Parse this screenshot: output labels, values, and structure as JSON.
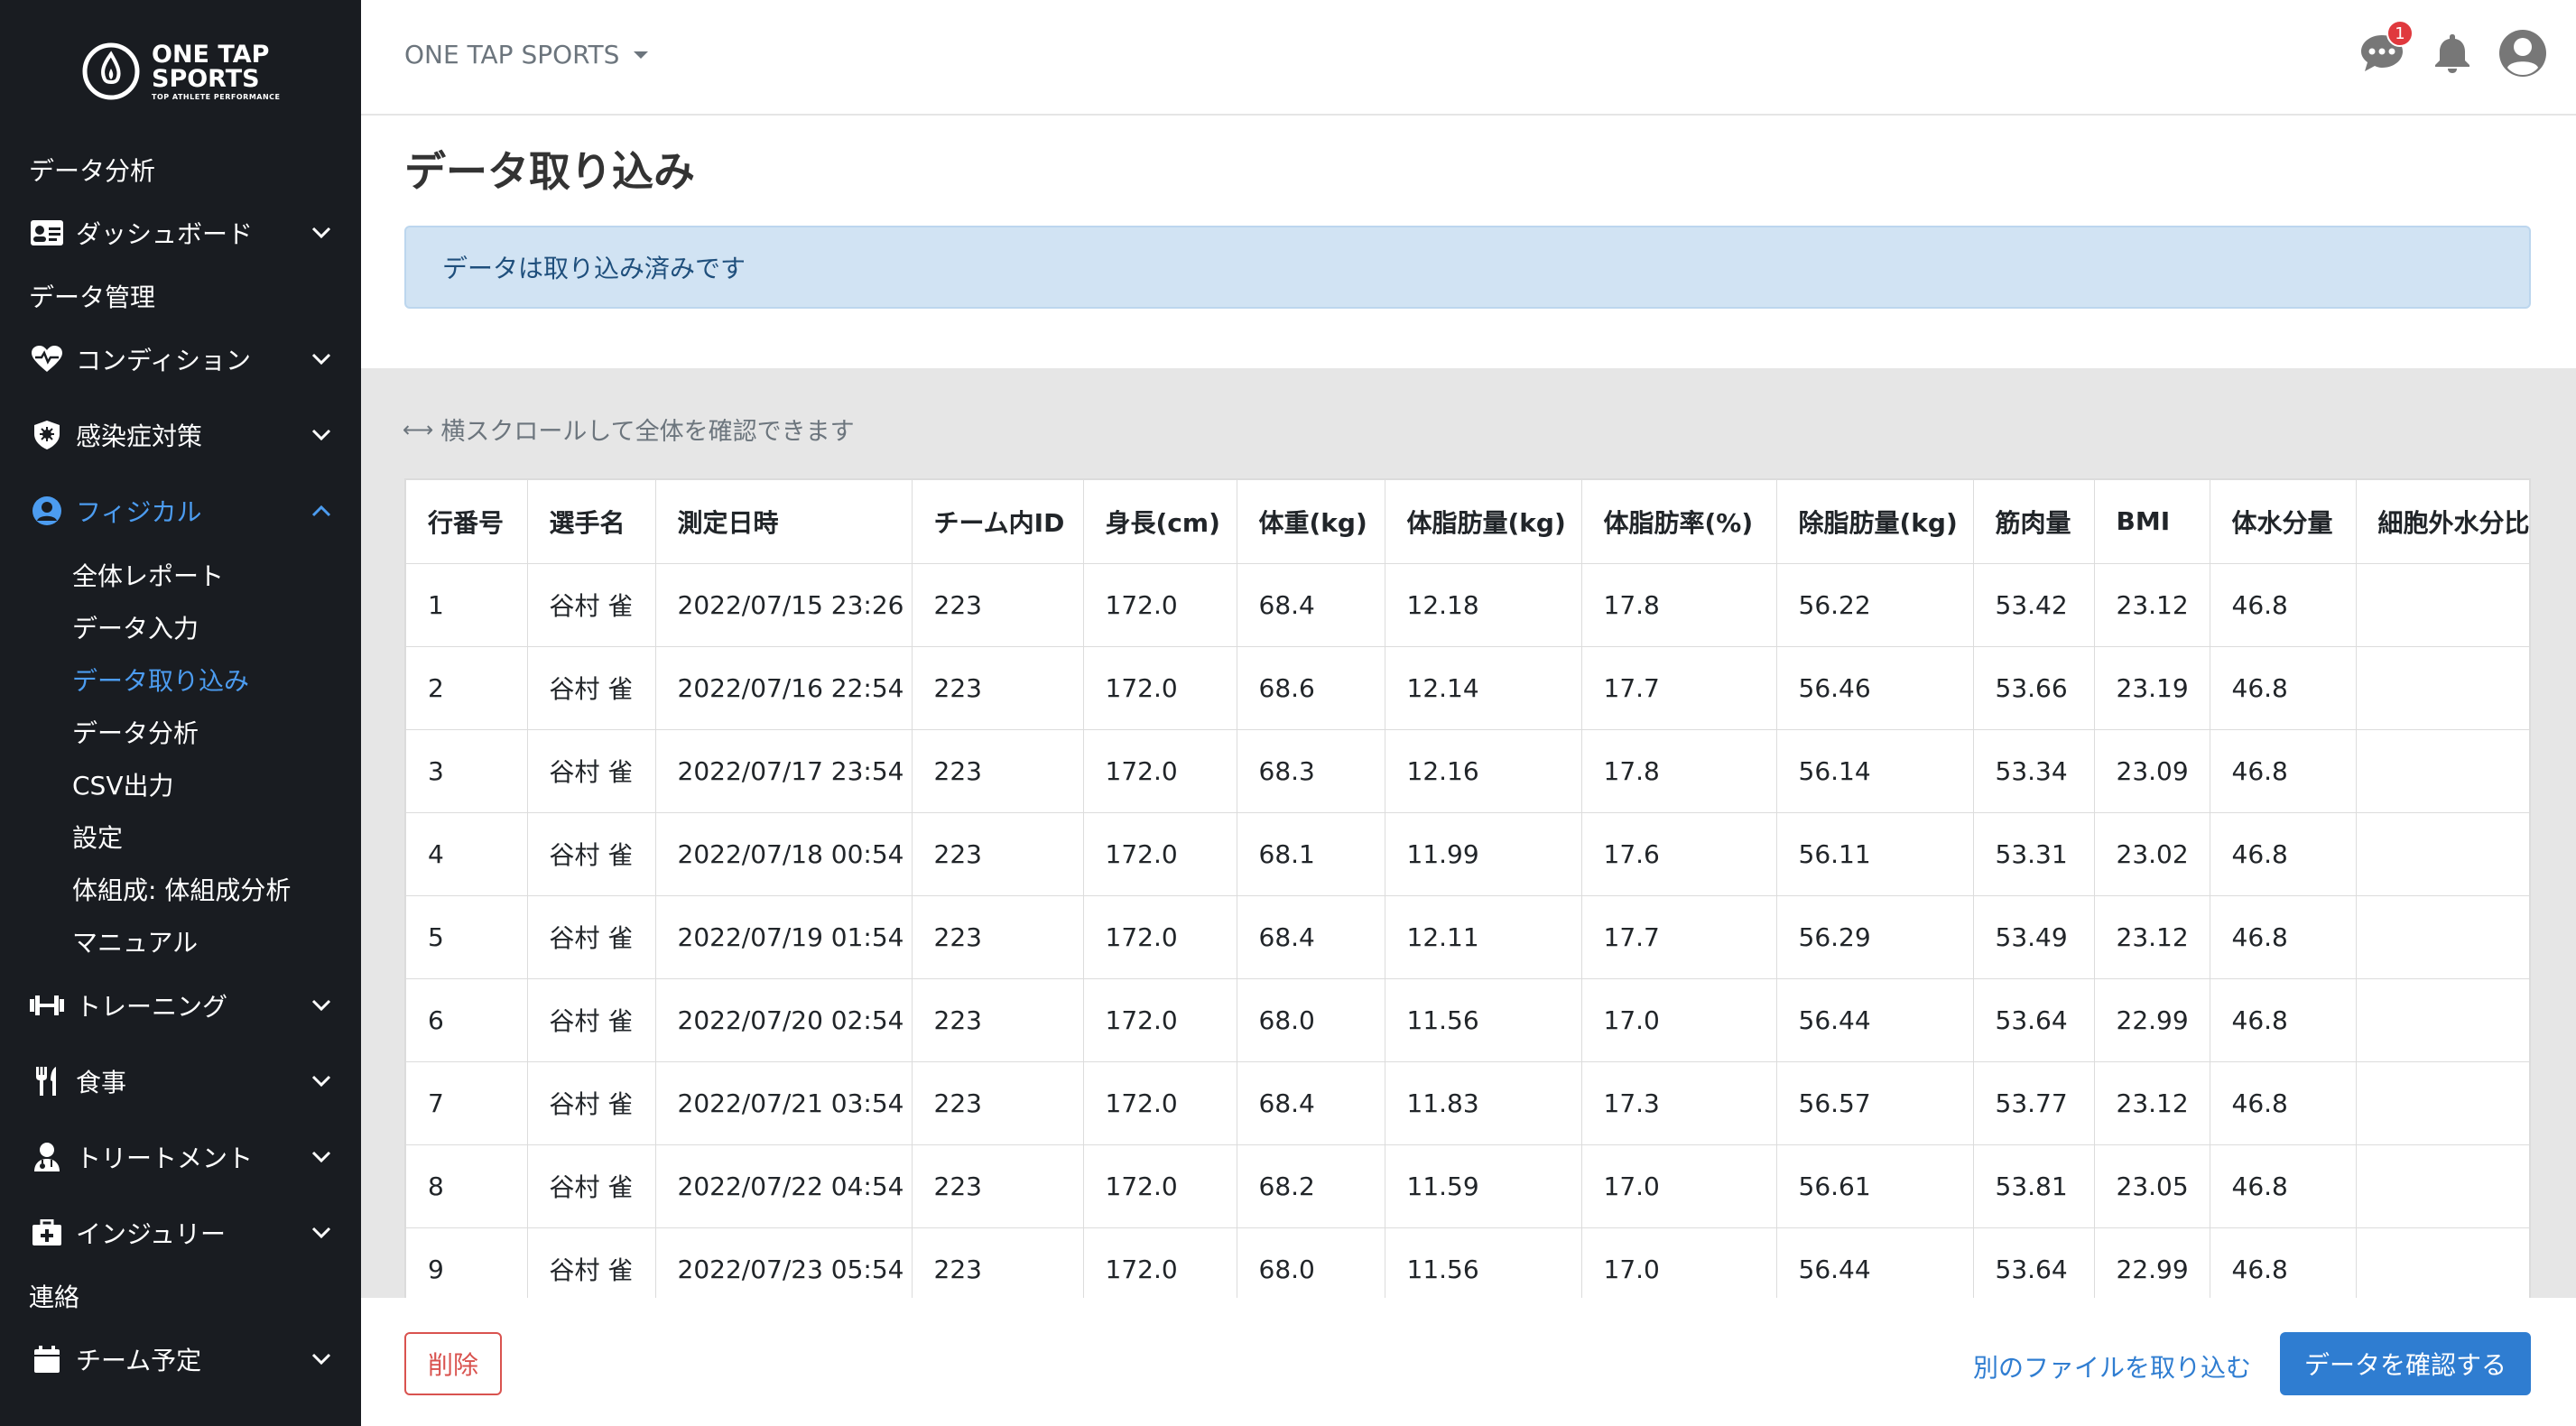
{
  "brand": {
    "line1": "ONE TAP",
    "line2": "SPORTS",
    "tagline": "TOP ATHLETE PERFORMANCE"
  },
  "topbar": {
    "team_name": "ONE TAP SPORTS",
    "message_badge": "1"
  },
  "sidebar": {
    "sections": [
      {
        "heading": "データ分析",
        "groups": [
          {
            "label": "ダッシュボード",
            "icon": "id-card-icon"
          }
        ]
      },
      {
        "heading": "データ管理",
        "groups": [
          {
            "label": "コンディション",
            "icon": "heart-pulse-icon"
          },
          {
            "label": "感染症対策",
            "icon": "virus-shield-icon"
          },
          {
            "label": "フィジカル",
            "icon": "user-circle-icon",
            "active": true,
            "items": [
              "全体レポート",
              "データ入力",
              "データ取り込み",
              "データ分析",
              "CSV出力",
              "設定",
              "体組成: 体組成分析",
              "マニュアル"
            ]
          },
          {
            "label": "トレーニング",
            "icon": "dumbbell-icon"
          },
          {
            "label": "食事",
            "icon": "utensils-icon"
          },
          {
            "label": "トリートメント",
            "icon": "user-doctor-icon"
          },
          {
            "label": "インジュリー",
            "icon": "medkit-icon"
          }
        ]
      },
      {
        "heading": "連絡",
        "groups": [
          {
            "label": "チーム予定",
            "icon": "calendar-icon"
          }
        ]
      }
    ]
  },
  "page": {
    "title": "データ取り込み",
    "alert": "データは取り込み済みです",
    "scroll_hint": "横スクロールして全体を確認できます"
  },
  "table": {
    "columns": [
      "行番号",
      "選手名",
      "測定日時",
      "チーム内ID",
      "身長(cm)",
      "体重(kg)",
      "体脂肪量(kg)",
      "体脂肪率(%)",
      "除脂肪量(kg)",
      "筋肉量",
      "BMI",
      "体水分量",
      "細胞外水分比"
    ],
    "rows": [
      [
        "1",
        "谷村 雀",
        "2022/07/15 23:26",
        "223",
        "172.0",
        "68.4",
        "12.18",
        "17.8",
        "56.22",
        "53.42",
        "23.12",
        "46.8",
        ""
      ],
      [
        "2",
        "谷村 雀",
        "2022/07/16 22:54",
        "223",
        "172.0",
        "68.6",
        "12.14",
        "17.7",
        "56.46",
        "53.66",
        "23.19",
        "46.8",
        ""
      ],
      [
        "3",
        "谷村 雀",
        "2022/07/17 23:54",
        "223",
        "172.0",
        "68.3",
        "12.16",
        "17.8",
        "56.14",
        "53.34",
        "23.09",
        "46.8",
        ""
      ],
      [
        "4",
        "谷村 雀",
        "2022/07/18 00:54",
        "223",
        "172.0",
        "68.1",
        "11.99",
        "17.6",
        "56.11",
        "53.31",
        "23.02",
        "46.8",
        ""
      ],
      [
        "5",
        "谷村 雀",
        "2022/07/19 01:54",
        "223",
        "172.0",
        "68.4",
        "12.11",
        "17.7",
        "56.29",
        "53.49",
        "23.12",
        "46.8",
        ""
      ],
      [
        "6",
        "谷村 雀",
        "2022/07/20 02:54",
        "223",
        "172.0",
        "68.0",
        "11.56",
        "17.0",
        "56.44",
        "53.64",
        "22.99",
        "46.8",
        ""
      ],
      [
        "7",
        "谷村 雀",
        "2022/07/21 03:54",
        "223",
        "172.0",
        "68.4",
        "11.83",
        "17.3",
        "56.57",
        "53.77",
        "23.12",
        "46.8",
        ""
      ],
      [
        "8",
        "谷村 雀",
        "2022/07/22 04:54",
        "223",
        "172.0",
        "68.2",
        "11.59",
        "17.0",
        "56.61",
        "53.81",
        "23.05",
        "46.8",
        ""
      ],
      [
        "9",
        "谷村 雀",
        "2022/07/23 05:54",
        "223",
        "172.0",
        "68.0",
        "11.56",
        "17.0",
        "56.44",
        "53.64",
        "22.99",
        "46.8",
        ""
      ]
    ]
  },
  "footer": {
    "delete_label": "削除",
    "other_file_label": "別のファイルを取り込む",
    "confirm_label": "データを確認する"
  },
  "colors": {
    "sidebar_bg": "#191c21",
    "accent": "#2f7dd1",
    "active_nav": "#4c9cf0",
    "danger": "#d9534f",
    "alert_bg": "#d1e3f3"
  }
}
